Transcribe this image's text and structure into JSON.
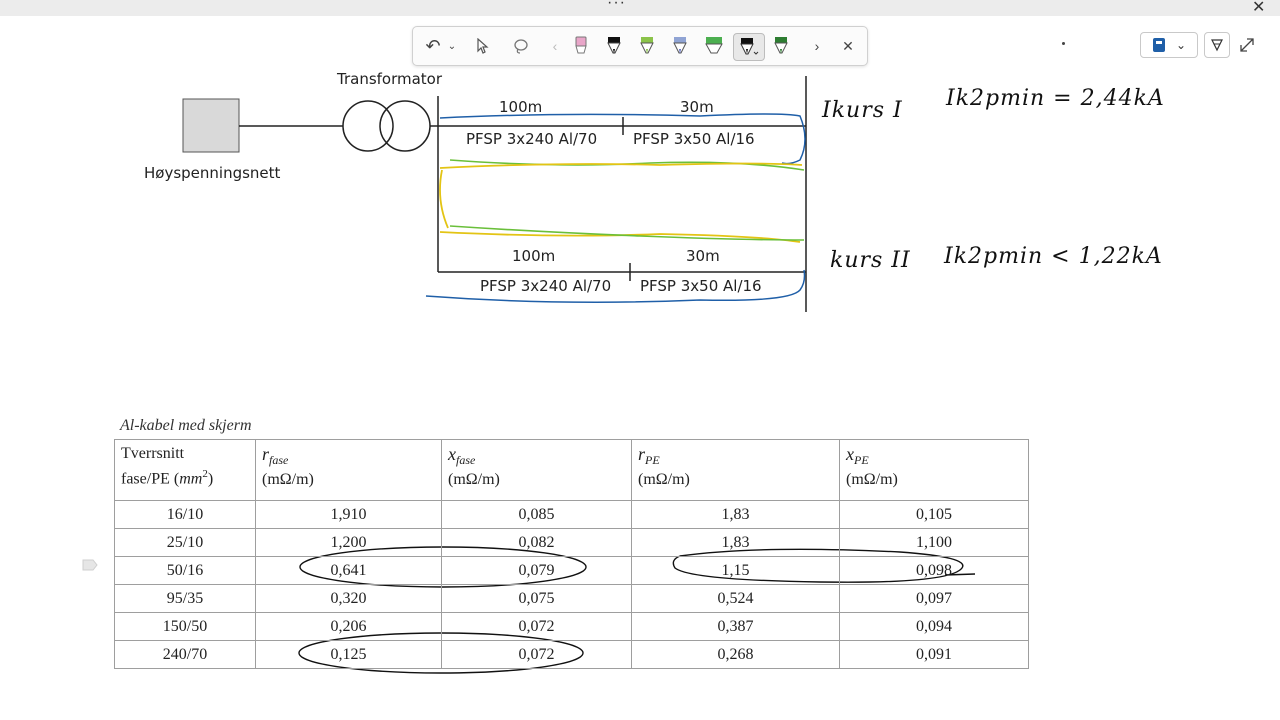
{
  "window": {
    "menu_dots": "···",
    "close_glyph": "✕"
  },
  "pen_toolbar": {
    "undo_glyph": "↶",
    "undo_dropdown": "⌄",
    "prev_glyph": "‹",
    "next_glyph": "›",
    "close_glyph": "✕",
    "pens": [
      {
        "icon": "pink-highlighter-icon",
        "color": "#e9a6c9"
      },
      {
        "icon": "black-pen-icon",
        "color": "#111111"
      },
      {
        "icon": "green-pen-icon",
        "color": "#8bc34a"
      },
      {
        "icon": "blue-pen-icon",
        "color": "#90a4d4"
      },
      {
        "icon": "green-highlighter-icon",
        "color": "#4caf50"
      },
      {
        "icon": "black-pen-selected-icon",
        "color": "#111111"
      },
      {
        "icon": "dark-green-pen-icon",
        "color": "#2e7d32"
      }
    ]
  },
  "right_tools": {
    "notebook_icon": "notebook-icon",
    "dropdown_glyph": "⌄",
    "pen_mode_icon": "pen-mode-icon",
    "expand_icon": "expand-icon"
  },
  "diagram": {
    "grid_label": "Høyspenningsnett",
    "transformer_label": "Transformator",
    "line1": {
      "len1": "100m",
      "len2": "30m",
      "cable1": "PFSP 3x240 Al/70",
      "cable2": "PFSP 3x50 Al/16"
    },
    "line2": {
      "len1": "100m",
      "len2": "30m",
      "cable1": "PFSP 3x240 Al/70",
      "cable2": "PFSP 3x50 Al/16"
    }
  },
  "handwriting": {
    "kurs1": "Ikurs I",
    "ik1": "Ik2pmin = 2,44kA",
    "kurs2": "kurs II",
    "ik2": "Ik2pmin < 1,22kA"
  },
  "table": {
    "caption": "Al-kabel med skjerm",
    "header": {
      "col1_line1": "Tverrsnitt",
      "col1_line2_pre": "fase/PE (",
      "col1_unit": "mm",
      "col1_exp": "2",
      "col1_line2_post": ")",
      "c2_sym": "r",
      "c2_sub": "fase",
      "c2_unit": "(mΩ/m)",
      "c3_sym": "x",
      "c3_sub": "fase",
      "c3_unit": "(mΩ/m)",
      "c4_sym": "r",
      "c4_sub": "PE",
      "c4_unit": "(mΩ/m)",
      "c5_sym": "x",
      "c5_sub": "PE",
      "c5_unit": "(mΩ/m)"
    },
    "rows": [
      [
        "16/10",
        "1,910",
        "0,085",
        "1,83",
        "0,105"
      ],
      [
        "25/10",
        "1,200",
        "0,082",
        "1,83",
        "1,100"
      ],
      [
        "50/16",
        "0,641",
        "0,079",
        "1,15",
        "0,098"
      ],
      [
        "95/35",
        "0,320",
        "0,075",
        "0,524",
        "0,097"
      ],
      [
        "150/50",
        "0,206",
        "0,072",
        "0,387",
        "0,094"
      ],
      [
        "240/70",
        "0,125",
        "0,072",
        "0,268",
        "0,091"
      ]
    ]
  }
}
